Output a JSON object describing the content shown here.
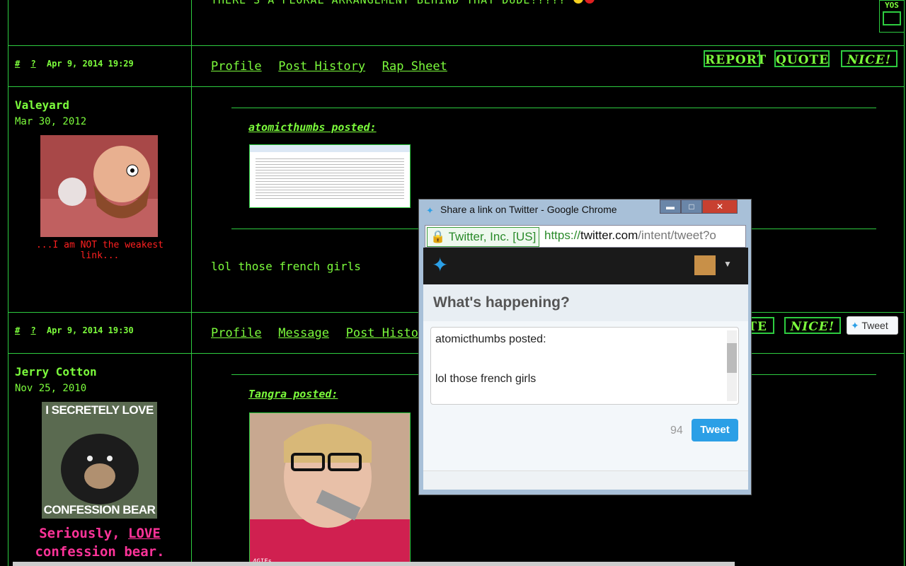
{
  "top_post": {
    "text": "THERE'S A FLORAL ARRANGEMENT BEHIND THAT DUDE!???? ",
    "corner_badge": "YOS"
  },
  "post1": {
    "hash": "#",
    "question": "?",
    "timestamp": "Apr 9, 2014 19:29",
    "links": [
      "Profile",
      "Post History",
      "Rap Sheet"
    ],
    "buttons": {
      "report": "REPORT",
      "quote": "QUOTE",
      "nice": "NICE!"
    },
    "user": {
      "name": "Valeyard",
      "joined": "Mar 30, 2012",
      "tagline": "...I am NOT the weakest link..."
    },
    "quote_author": "atomicthumbs posted:",
    "body": "lol those french girls"
  },
  "post2": {
    "hash": "#",
    "question": "?",
    "timestamp": "Apr 9, 2014 19:30",
    "links": [
      "Profile",
      "Message",
      "Post History"
    ],
    "buttons": {
      "quote_partial": "TE",
      "nice": "NICE!",
      "tweet": "Tweet"
    },
    "user": {
      "name": "Jerry Cotton",
      "joined": "Nov 25, 2010",
      "meme_top": "I SECRETELY LOVE",
      "meme_bottom": "CONFESSION BEAR",
      "tagline_1": "Seriously, ",
      "tagline_love": "LOVE",
      "tagline_2": "confession bear."
    },
    "quote_author": "Tangra posted:",
    "image_caption": "4GIFs"
  },
  "popup": {
    "title": "Share a link on Twitter - Google Chrome",
    "cert": "Twitter, Inc. [US]",
    "url_scheme": "https://",
    "url_domain": "twitter.com",
    "url_path": "/intent/tweet?o",
    "prompt": "What's happening?",
    "tweet_line1": "atomicthumbs posted:",
    "tweet_line2": "lol those french girls",
    "char_count": "94",
    "tweet_button": "Tweet"
  },
  "colors": {
    "accent": "#7CFC3C",
    "border": "#2ecc40",
    "tagline_red": "#ff2020",
    "tagline_pink": "#ff3399",
    "twitter_blue": "#2b9fe6"
  }
}
